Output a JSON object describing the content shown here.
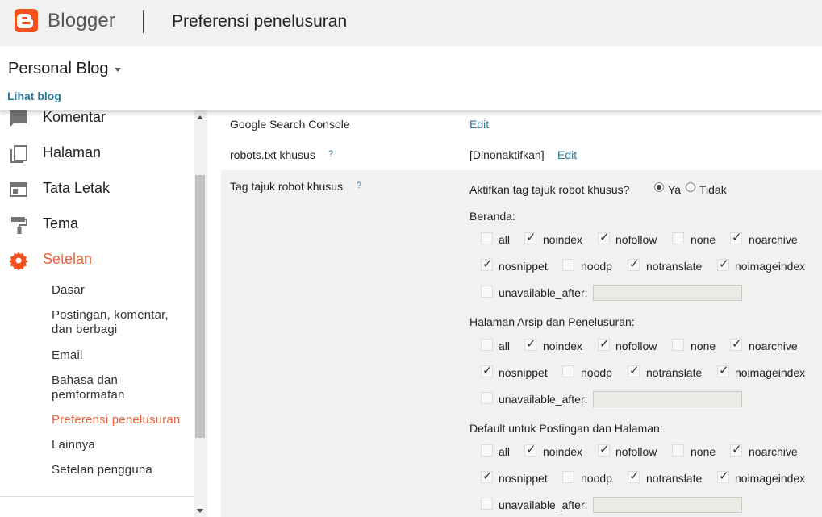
{
  "header": {
    "brand": "Blogger",
    "page_title": "Preferensi penelusuran"
  },
  "blog": {
    "name": "Personal Blog",
    "view_link": "Lihat blog"
  },
  "sidebar": {
    "items": [
      {
        "label": "Komentar",
        "icon": "comment-icon"
      },
      {
        "label": "Halaman",
        "icon": "pages-icon"
      },
      {
        "label": "Tata Letak",
        "icon": "layout-icon"
      },
      {
        "label": "Tema",
        "icon": "theme-roller-icon"
      },
      {
        "label": "Setelan",
        "icon": "gear-icon",
        "active": true
      }
    ],
    "sub_items": [
      "Dasar",
      "Postingan, komentar, dan berbagi",
      "Email",
      "Bahasa dan pemformatan",
      "Preferensi penelusuran",
      "Lainnya",
      "Setelan pengguna"
    ],
    "active_sub": "Preferensi penelusuran"
  },
  "main": {
    "search_console": {
      "label": "Google Search Console",
      "action": "Edit"
    },
    "robots_txt": {
      "label": "robots.txt khusus",
      "help": "?",
      "status": "[Dinonaktifkan]",
      "action": "Edit"
    },
    "robot_tags": {
      "label": "Tag tajuk robot khusus",
      "help": "?",
      "enable_question": "Aktifkan tag tajuk robot khusus?",
      "yes": "Ya",
      "no": "Tidak",
      "selected": "Ya",
      "sections": [
        {
          "title": "Beranda:",
          "options": [
            {
              "name": "all",
              "checked": false
            },
            {
              "name": "noindex",
              "checked": true
            },
            {
              "name": "nofollow",
              "checked": true
            },
            {
              "name": "none",
              "checked": false
            },
            {
              "name": "noarchive",
              "checked": true
            },
            {
              "name": "nosnippet",
              "checked": true
            },
            {
              "name": "noodp",
              "checked": false
            },
            {
              "name": "notranslate",
              "checked": true
            },
            {
              "name": "noimageindex",
              "checked": true
            },
            {
              "name": "unavailable_after:",
              "checked": false
            }
          ]
        },
        {
          "title": "Halaman Arsip dan Penelusuran:",
          "options": [
            {
              "name": "all",
              "checked": false
            },
            {
              "name": "noindex",
              "checked": true
            },
            {
              "name": "nofollow",
              "checked": true
            },
            {
              "name": "none",
              "checked": false
            },
            {
              "name": "noarchive",
              "checked": true
            },
            {
              "name": "nosnippet",
              "checked": true
            },
            {
              "name": "noodp",
              "checked": false
            },
            {
              "name": "notranslate",
              "checked": true
            },
            {
              "name": "noimageindex",
              "checked": true
            },
            {
              "name": "unavailable_after:",
              "checked": false
            }
          ]
        },
        {
          "title": "Default untuk Postingan dan Halaman:",
          "options": [
            {
              "name": "all",
              "checked": false
            },
            {
              "name": "noindex",
              "checked": true
            },
            {
              "name": "nofollow",
              "checked": true
            },
            {
              "name": "none",
              "checked": false
            },
            {
              "name": "noarchive",
              "checked": true
            },
            {
              "name": "nosnippet",
              "checked": true
            },
            {
              "name": "noodp",
              "checked": false
            },
            {
              "name": "notranslate",
              "checked": true
            },
            {
              "name": "noimageindex",
              "checked": true
            },
            {
              "name": "unavailable_after:",
              "checked": false
            }
          ]
        }
      ]
    }
  },
  "colors": {
    "brand_orange": "#f4511e",
    "active_orange": "#e8633a",
    "link_blue": "#2b7a9c"
  }
}
